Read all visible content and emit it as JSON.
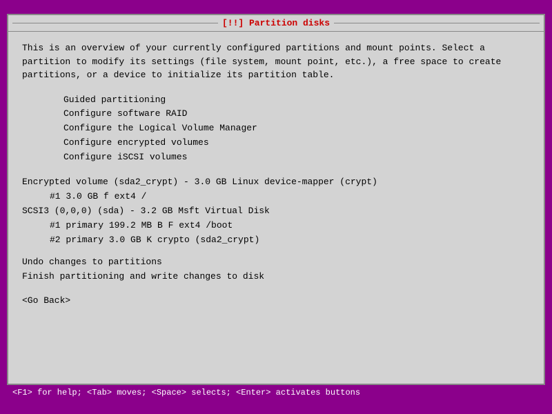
{
  "title": "[!!] Partition disks",
  "description": "This is an overview of your currently configured partitions and mount points. Select a partition to modify its settings (file system, mount point, etc.), a free space to create partitions, or a device to initialize its partition table.",
  "menu_items": [
    "Guided partitioning",
    "Configure software RAID",
    "Configure the Logical Volume Manager",
    "Configure encrypted volumes",
    "Configure iSCSI volumes"
  ],
  "partitions": {
    "encrypted_volume": "Encrypted volume (sda2_crypt) - 3.0 GB Linux device-mapper (crypt)",
    "enc_part1": "          #1          3.0 GB     f  ext4         /",
    "scsi_device": "SCSI3 (0,0,0) (sda) - 3.2 GB Msft Virtual Disk",
    "scsi_part1": "          #1  primary   199.2 MB  B  F  ext4      /boot",
    "scsi_part2": "          #2  primary     3.0 GB     K  crypto    (sda2_crypt)"
  },
  "actions": {
    "undo": "Undo changes to partitions",
    "finish": "Finish partitioning and write changes to disk"
  },
  "go_back": "<Go Back>",
  "status_bar": "<F1> for help; <Tab> moves; <Space> selects; <Enter> activates buttons"
}
